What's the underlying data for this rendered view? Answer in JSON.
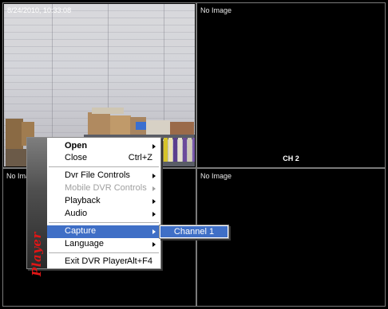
{
  "panes": [
    {
      "timestamp": "8/24/2010, 10:33:08",
      "channel": ""
    },
    {
      "status": "No Image",
      "channel": "CH 2"
    },
    {
      "status": "No Image",
      "channel": ""
    },
    {
      "status": "No Image",
      "channel": ""
    }
  ],
  "menu": {
    "banner": "Player",
    "items": {
      "open": {
        "label": "Open"
      },
      "close": {
        "label": "Close",
        "shortcut": "Ctrl+Z"
      },
      "dvr_file_controls": {
        "label": "Dvr File Controls"
      },
      "mobile_dvr_controls": {
        "label": "Mobile DVR Controls"
      },
      "playback": {
        "label": "Playback"
      },
      "audio": {
        "label": "Audio"
      },
      "capture": {
        "label": "Capture"
      },
      "language": {
        "label": "Language"
      },
      "exit": {
        "label": "Exit DVR Player",
        "shortcut": "Alt+F4"
      }
    },
    "highlight_color": "#3f6fc6"
  },
  "submenu": {
    "items": [
      {
        "label": "Channel 1"
      }
    ]
  }
}
